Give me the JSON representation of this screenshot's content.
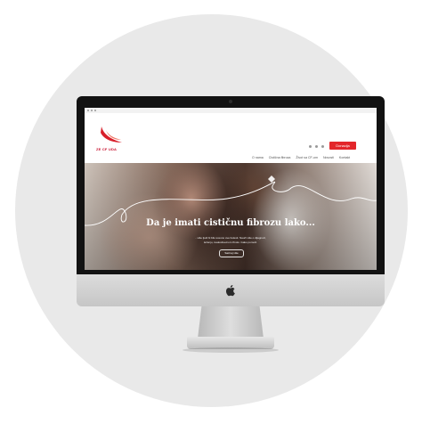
{
  "site": {
    "logo_text": "ZE CF UDA",
    "donate_label": "Donacija",
    "nav": [
      "O nama",
      "Cistična fibroza",
      "Život sa CF-om",
      "Novosti",
      "Kontakt"
    ]
  },
  "hero": {
    "title": "Da je imati cističnu fibrozu lako...",
    "subtitle_lines": [
      "...više ljudi bi bilo svesno ove bolesti. Nauči više o dijagnozi,",
      "lečenju, svakodnevnom životu i kako pomoći."
    ],
    "button_label": "Saznaj više"
  },
  "colors": {
    "brand_red": "#e3262a",
    "logo_red": "#c8102e",
    "background_circle": "#e9e9e9"
  },
  "icons": [
    "apple-logo-icon",
    "search-icon",
    "facebook-icon",
    "instagram-icon"
  ]
}
